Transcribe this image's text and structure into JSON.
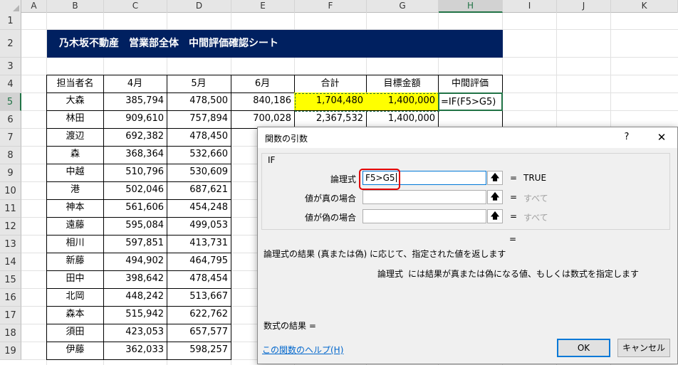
{
  "columns": [
    "A",
    "B",
    "C",
    "D",
    "E",
    "F",
    "G",
    "H",
    "I",
    "J",
    "K"
  ],
  "rows": [
    "1",
    "2",
    "3",
    "4",
    "5",
    "6",
    "7",
    "8",
    "9",
    "10",
    "11",
    "12",
    "13",
    "14",
    "15",
    "16",
    "17",
    "18",
    "19"
  ],
  "title": "乃木坂不動産　営業部全体　中間評価確認シート",
  "table": {
    "headers": [
      "担当者名",
      "4月",
      "5月",
      "6月",
      "合計",
      "目標金額",
      "中間評価"
    ],
    "rows": [
      [
        "大森",
        "385,794",
        "478,500",
        "840,186",
        "1,704,480",
        "1,400,000",
        ""
      ],
      [
        "林田",
        "909,610",
        "757,894",
        "700,028",
        "2,367,532",
        "1,400,000",
        ""
      ],
      [
        "渡辺",
        "692,382",
        "478,450",
        "",
        "",
        "",
        ""
      ],
      [
        "森",
        "368,364",
        "532,660",
        "",
        "",
        "",
        ""
      ],
      [
        "中越",
        "510,796",
        "530,609",
        "",
        "",
        "",
        ""
      ],
      [
        "港",
        "502,046",
        "687,621",
        "",
        "",
        "",
        ""
      ],
      [
        "神本",
        "561,606",
        "454,248",
        "",
        "",
        "",
        ""
      ],
      [
        "遠藤",
        "595,084",
        "499,053",
        "",
        "",
        "",
        ""
      ],
      [
        "相川",
        "597,851",
        "413,731",
        "",
        "",
        "",
        ""
      ],
      [
        "新藤",
        "494,902",
        "464,795",
        "",
        "",
        "",
        ""
      ],
      [
        "田中",
        "398,642",
        "478,454",
        "",
        "",
        "",
        ""
      ],
      [
        "北岡",
        "448,242",
        "513,667",
        "",
        "",
        "",
        ""
      ],
      [
        "森本",
        "515,942",
        "622,762",
        "",
        "",
        "",
        ""
      ],
      [
        "須田",
        "423,053",
        "657,577",
        "",
        "",
        "",
        ""
      ],
      [
        "伊藤",
        "362,033",
        "598,257",
        "",
        "",
        "",
        ""
      ]
    ],
    "editing_formula": "=IF(F5>G5)"
  },
  "dialog": {
    "title": "関数の引数",
    "help_button": "?",
    "close_button": "✕",
    "function_name": "IF",
    "args": [
      {
        "label": "論理式",
        "value": "F5>G5",
        "result": "TRUE"
      },
      {
        "label": "値が真の場合",
        "value": "",
        "result": "すべて"
      },
      {
        "label": "値が偽の場合",
        "value": "",
        "result": "すべて"
      }
    ],
    "equals": "=",
    "overall_equals": "=",
    "description": "論理式の結果 (真または偽) に応じて、指定された値を返します",
    "arg_desc_name": "論理式",
    "arg_desc_text": "には結果が真または偽になる値、もしくは数式を指定します",
    "formula_result_label": "数式の結果 =",
    "help_link": "この関数のヘルプ(H)",
    "ok_label": "OK",
    "cancel_label": "キャンセル",
    "ref_icon": "collapse-dialog-icon"
  },
  "colors": {
    "title_bg": "#002060",
    "highlight": "#ffff00",
    "excel_green": "#217346",
    "annotation_red": "#e00000"
  }
}
